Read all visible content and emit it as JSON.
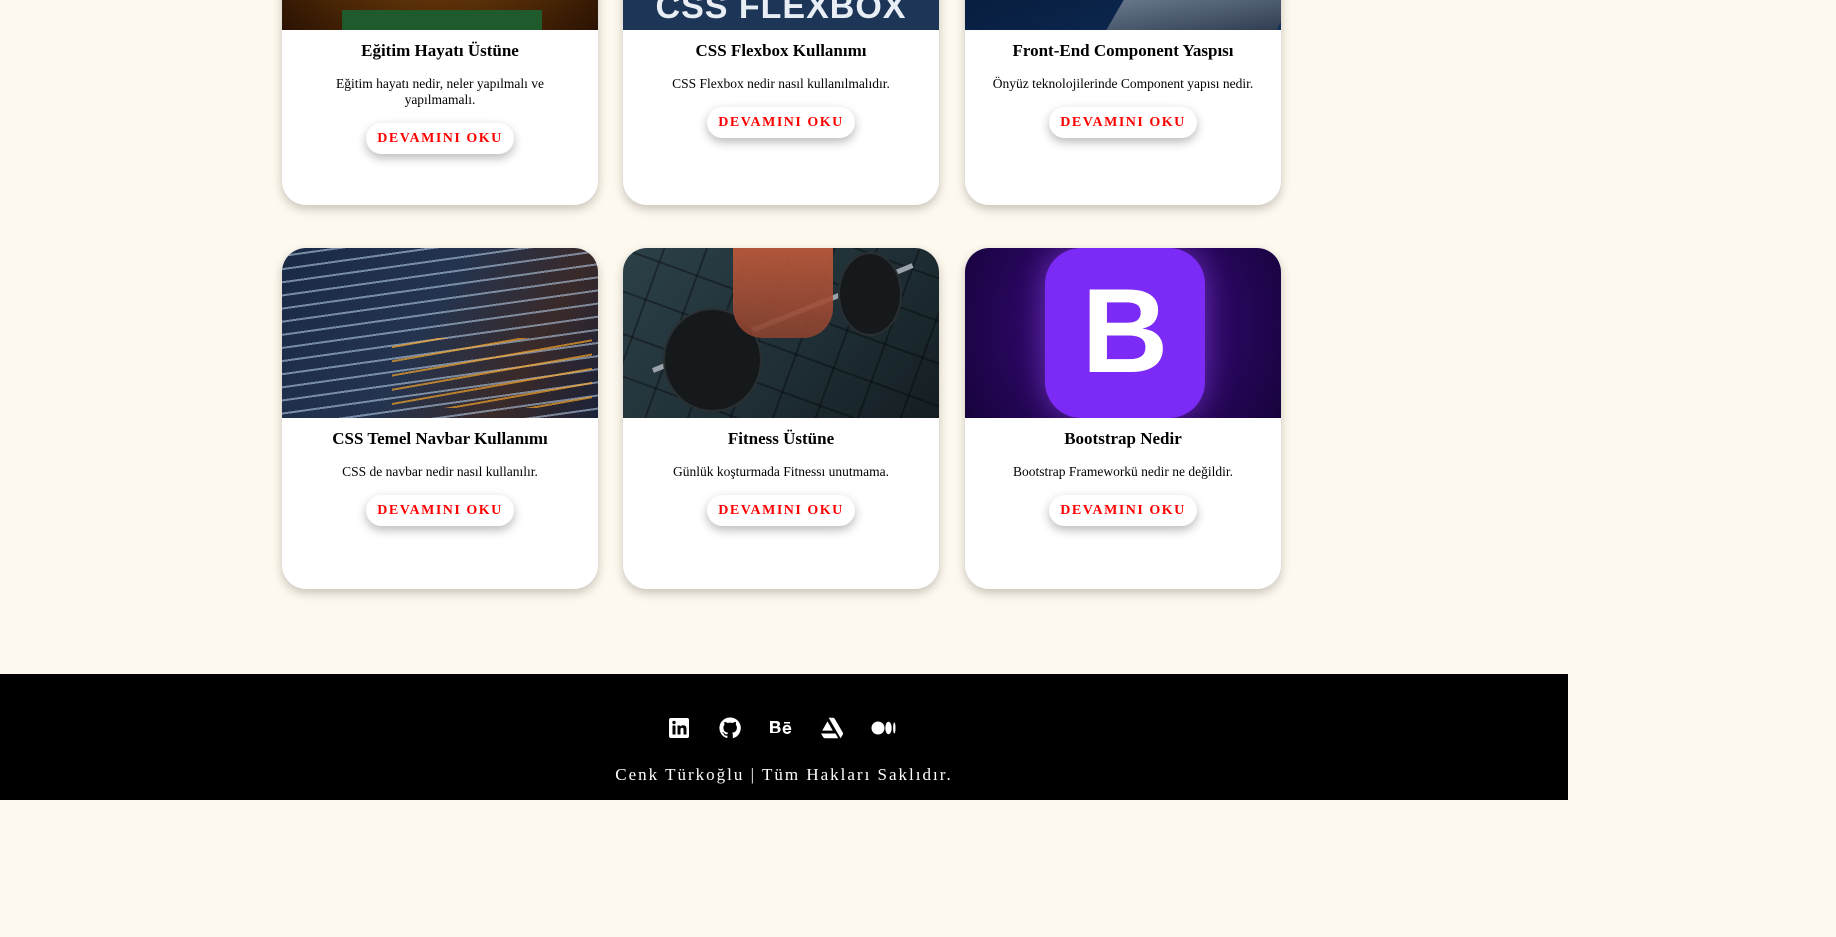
{
  "cards_row1": [
    {
      "title": "Eğitim Hayatı Üstüne",
      "desc": "Eğitim hayatı nedir, neler yapılmalı ve yapılmamalı.",
      "button": "DEVAMINI OKU",
      "image": "books-image"
    },
    {
      "title": "CSS Flexbox Kullanımı",
      "desc": "CSS Flexbox nedir nasıl kullanılmalıdır.",
      "button": "DEVAMINI OKU",
      "image": "css-flexbox-image",
      "image_text": "CSS FLEXBOX"
    },
    {
      "title": "Front-End Component Yaspısı",
      "desc": "Önyüz teknolojilerinde Component yapısı nedir.",
      "button": "DEVAMINI OKU",
      "image": "laptop-image"
    }
  ],
  "cards_row2": [
    {
      "title": "CSS Temel Navbar Kullanımı",
      "desc": "CSS de navbar nedir nasıl kullanılır.",
      "button": "DEVAMINI OKU",
      "image": "code-screen-image"
    },
    {
      "title": "Fitness Üstüne",
      "desc": "Günlük koşturmada Fitnessı unutmama.",
      "button": "DEVAMINI OKU",
      "image": "barbell-image"
    },
    {
      "title": "Bootstrap Nedir",
      "desc": "Bootstrap Frameworkü nedir ne değildir.",
      "button": "DEVAMINI OKU",
      "image": "bootstrap-logo-image",
      "image_text": "B"
    }
  ],
  "footer": {
    "icons": [
      "linkedin-icon",
      "github-icon",
      "behance-icon",
      "artstation-icon",
      "medium-icon"
    ],
    "copyright": "Cenk Türkoğlu | Tüm Hakları Saklıdır."
  },
  "colors": {
    "background": "#fdf9ee",
    "button_text": "#ff0000",
    "footer": "#000000"
  }
}
